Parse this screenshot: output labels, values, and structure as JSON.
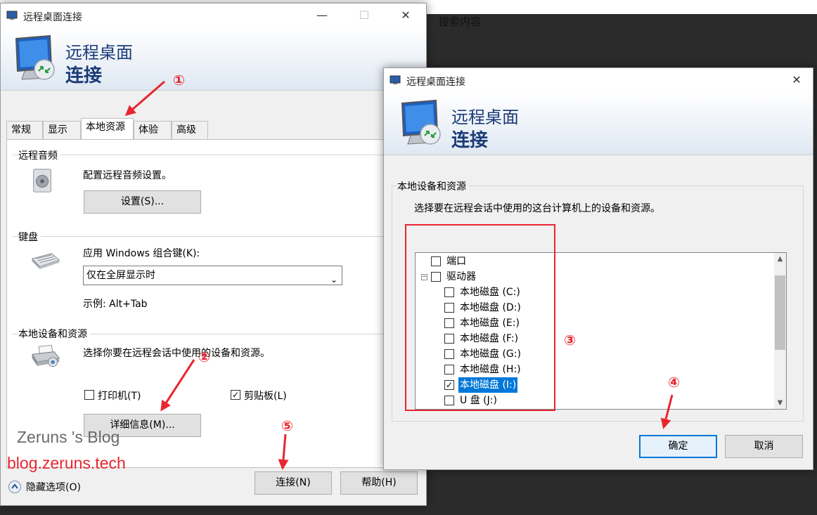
{
  "background": {
    "search_text": "搜索内容"
  },
  "main_window": {
    "title": "远程桌面连接",
    "brand_line1": "远程桌面",
    "brand_line2": "连接",
    "tabs": [
      {
        "label": "常规",
        "active": false
      },
      {
        "label": "显示",
        "active": false
      },
      {
        "label": "本地资源",
        "active": true
      },
      {
        "label": "体验",
        "active": false
      },
      {
        "label": "高级",
        "active": false
      }
    ],
    "audio": {
      "group_label": "远程音频",
      "description": "配置远程音频设置。",
      "settings_button": "设置(S)..."
    },
    "keyboard": {
      "group_label": "键盘",
      "description": "应用 Windows 组合键(K):",
      "selected_option": "仅在全屏显示时",
      "example": "示例: Alt+Tab"
    },
    "local_devices": {
      "group_label": "本地设备和资源",
      "description": "选择你要在远程会话中使用的设备和资源。",
      "printer_label": "打印机(T)",
      "printer_checked": false,
      "clipboard_label": "剪贴板(L)",
      "clipboard_checked": true,
      "details_button": "详细信息(M)..."
    },
    "hide_options": "隐藏选项(O)",
    "connect_button": "连接(N)",
    "help_button": "帮助(H)"
  },
  "dialog": {
    "title": "远程桌面连接",
    "brand_line1": "远程桌面",
    "brand_line2": "连接",
    "group_label": "本地设备和资源",
    "description": "选择要在远程会话中使用的这台计算机上的设备和资源。",
    "tree_items": [
      {
        "label": "端口",
        "checked": false,
        "level": 0,
        "selected": false
      },
      {
        "label": "驱动器",
        "checked": false,
        "level": 0,
        "expanded": true,
        "selected": false
      },
      {
        "label": "本地磁盘 (C:)",
        "checked": false,
        "level": 1,
        "selected": false
      },
      {
        "label": "本地磁盘 (D:)",
        "checked": false,
        "level": 1,
        "selected": false
      },
      {
        "label": "本地磁盘 (E:)",
        "checked": false,
        "level": 1,
        "selected": false
      },
      {
        "label": "本地磁盘 (F:)",
        "checked": false,
        "level": 1,
        "selected": false
      },
      {
        "label": "本地磁盘 (G:)",
        "checked": false,
        "level": 1,
        "selected": false
      },
      {
        "label": "本地磁盘 (H:)",
        "checked": false,
        "level": 1,
        "selected": false
      },
      {
        "label": "本地磁盘 (I:)",
        "checked": true,
        "level": 1,
        "selected": true
      },
      {
        "label": "U 盘 (J:)",
        "checked": false,
        "level": 1,
        "selected": false
      }
    ],
    "ok_button": "确定",
    "cancel_button": "取消"
  },
  "annotations": {
    "step1": "①",
    "step2": "②",
    "step3": "③",
    "step4": "④",
    "step5": "⑤",
    "color": "#e8262e"
  },
  "watermark": {
    "line1": "Zeruns 's Blog",
    "line2": "blog.zeruns.tech"
  },
  "colors": {
    "accent": "#0078d7",
    "brand_text": "#1b3a78",
    "annotation": "#e8262e"
  }
}
